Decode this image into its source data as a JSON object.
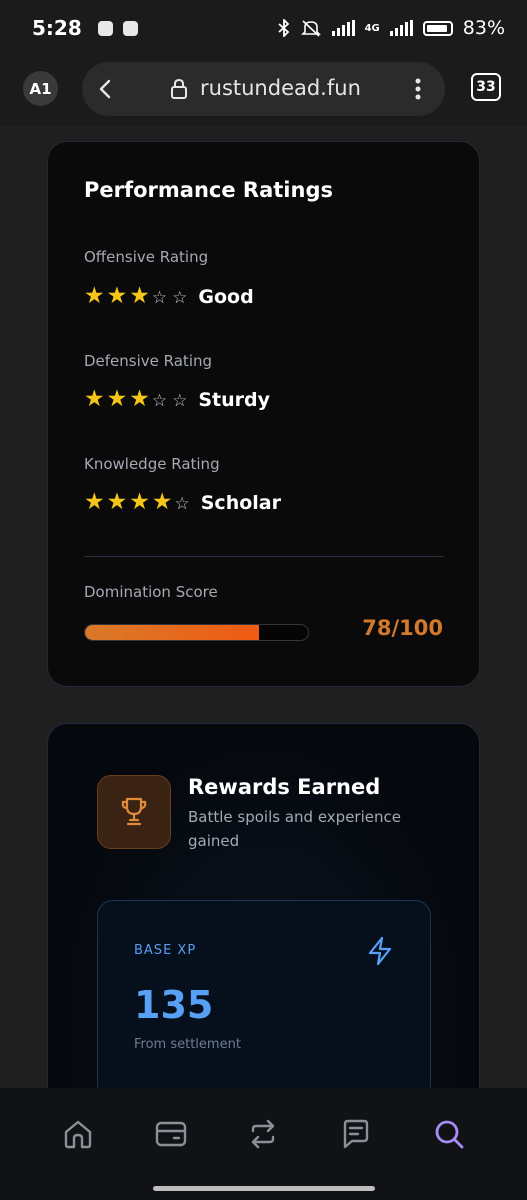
{
  "status_bar": {
    "time": "5:28",
    "network": "4G",
    "battery": "83%"
  },
  "browser": {
    "profile": "A1",
    "url": "rustundead.fun",
    "tab_count": "33"
  },
  "performance": {
    "title": "Performance Ratings",
    "ratings": [
      {
        "label": "Offensive Rating",
        "stars": 3,
        "max": 5,
        "word": "Good"
      },
      {
        "label": "Defensive Rating",
        "stars": 3,
        "max": 5,
        "word": "Sturdy"
      },
      {
        "label": "Knowledge Rating",
        "stars": 4,
        "max": 5,
        "word": "Scholar"
      }
    ],
    "domination_label": "Domination Score",
    "domination_value": "78/100",
    "domination_fraction": 0.78,
    "accent_color": "#d4782c"
  },
  "rewards": {
    "title": "Rewards Earned",
    "subtitle": "Battle spoils and experience gained",
    "trophy_icon": "trophy-icon",
    "xp_label": "BASE XP",
    "xp_value": "135",
    "xp_note": "From settlement",
    "xp_icon": "lightning-icon",
    "xp_color": "#58a0f5"
  },
  "bottom_nav": {
    "items": [
      "home-icon",
      "wallet-icon",
      "swap-icon",
      "chat-icon",
      "search-icon"
    ],
    "active": "search-icon",
    "active_color": "#a98cf5"
  }
}
